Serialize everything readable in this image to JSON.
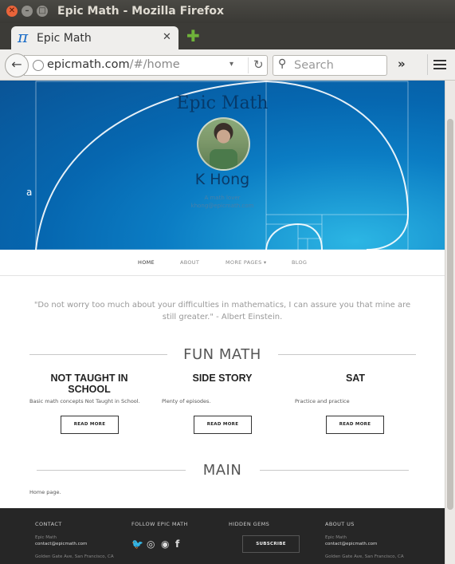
{
  "window": {
    "title": "Epic Math - Mozilla Firefox",
    "close_glyph": "✕",
    "min_glyph": "–",
    "max_glyph": "□"
  },
  "tab": {
    "title": "Epic Math",
    "icon_glyph": "π",
    "close_glyph": "✕"
  },
  "newtab_glyph": "✚",
  "nav": {
    "back_glyph": "←",
    "url_host": "epicmath.com",
    "url_path": "/#/home",
    "dropdown_glyph": "▾",
    "reload_glyph": "↻",
    "search_placeholder": "Search",
    "search_glyph": "⚲",
    "overflow_glyph": "»"
  },
  "hero": {
    "site_title": "Epic Math",
    "author": "K Hong",
    "tagline": "A math lover",
    "email": "khong@epicmath.com",
    "side_letter": "a",
    "spiral_color": "#ffffff"
  },
  "menu": {
    "items": [
      {
        "label": "HOME",
        "active": true
      },
      {
        "label": "ABOUT",
        "active": false
      },
      {
        "label": "MORE PAGES ▾",
        "active": false
      },
      {
        "label": "BLOG",
        "active": false
      }
    ]
  },
  "quote": "\"Do not worry too much about your difficulties in mathematics, I can assure you that mine are still greater.\" - Albert Einstein.",
  "sections": {
    "fun_math": "FUN MATH",
    "main": "MAIN"
  },
  "features": [
    {
      "title": "NOT TAUGHT IN SCHOOL",
      "desc": "Basic math concepts Not Taught in School.",
      "button": "READ MORE"
    },
    {
      "title": "SIDE STORY",
      "desc": "Plenty of episodes.",
      "button": "READ MORE"
    },
    {
      "title": "SAT",
      "desc": "Practice and practice",
      "button": "READ MORE"
    }
  ],
  "main_text": "Home page.",
  "footer": {
    "contact": {
      "heading": "CONTACT",
      "name": "Epic Math",
      "email": "contact@epicmath.com",
      "address": "Golden Gate Ave, San Francisco, CA"
    },
    "follow": {
      "heading": "FOLLOW EPIC MATH",
      "icons": [
        "twitter-icon",
        "dribbble-icon",
        "github-icon",
        "facebook-icon"
      ],
      "twitter_glyph": "🐦",
      "dribbble_glyph": "◎",
      "github_glyph": "◉",
      "facebook_glyph": "f"
    },
    "gems": {
      "heading": "HIDDEN GEMS",
      "button": "SUBSCRIBE"
    },
    "about": {
      "heading": "ABOUT US",
      "name": "Epic Math",
      "email": "contact@epicmath.com",
      "address": "Golden Gate Ave, San Francisco, CA"
    }
  },
  "colors": {
    "hero_blue": "#0667b0",
    "hero_light": "#2cb6e4",
    "footer_bg": "#262626",
    "firefox_chrome": "#3c3b37"
  }
}
